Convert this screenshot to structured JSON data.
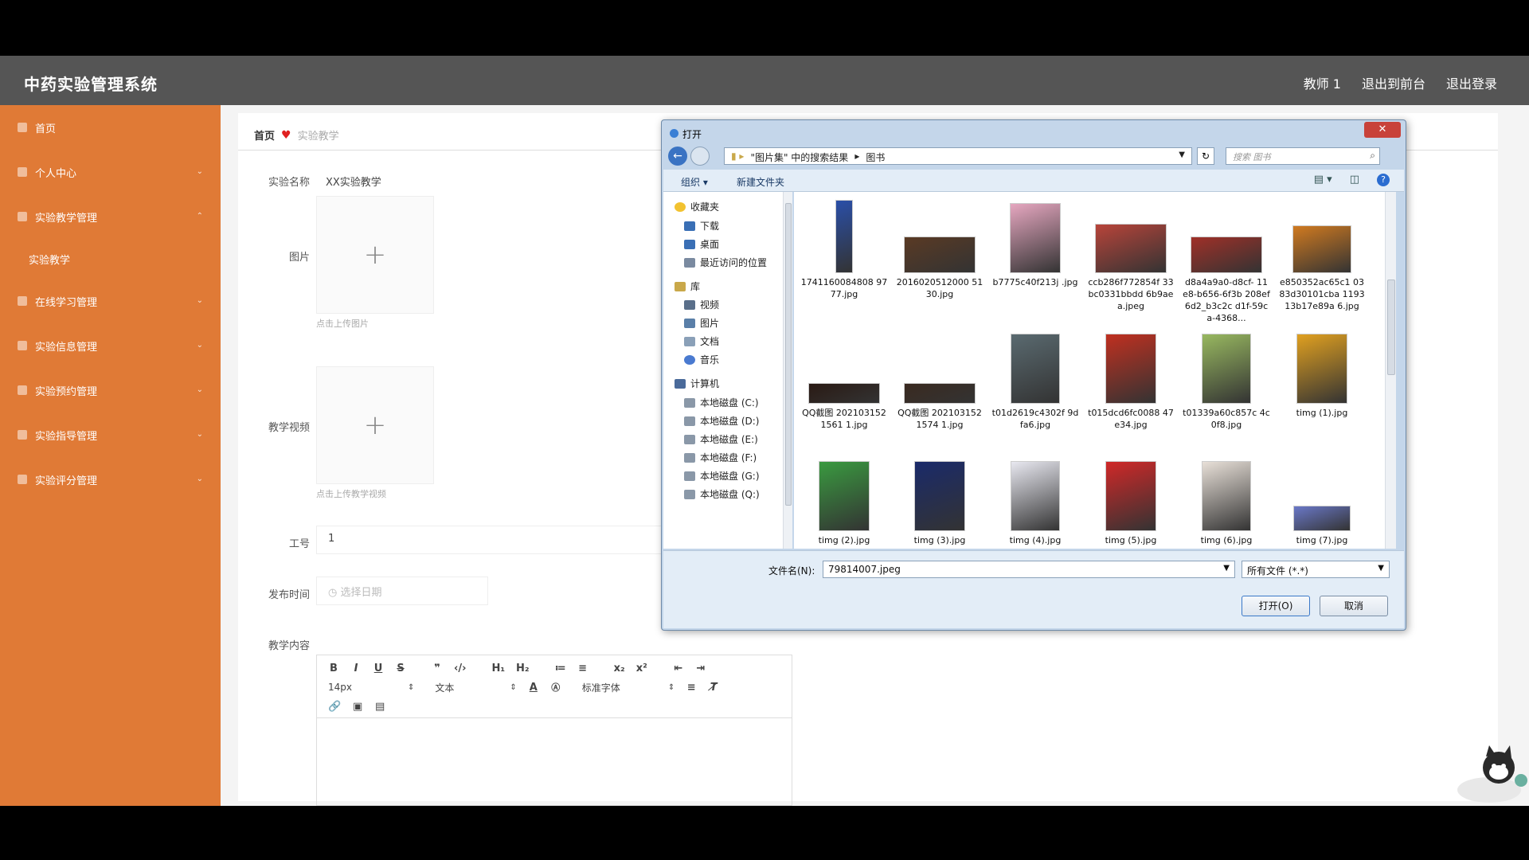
{
  "header": {
    "title": "中药实验管理系统",
    "nav": [
      "教师 1",
      "退出到前台",
      "退出登录"
    ]
  },
  "sidebar": {
    "items": [
      {
        "label": "首页",
        "expandable": false
      },
      {
        "label": "个人中心",
        "expandable": true
      },
      {
        "label": "实验教学管理",
        "expandable": true,
        "open": true
      },
      {
        "label": "在线学习管理",
        "expandable": true
      },
      {
        "label": "实验信息管理",
        "expandable": true
      },
      {
        "label": "实验预约管理",
        "expandable": true
      },
      {
        "label": "实验指导管理",
        "expandable": true
      },
      {
        "label": "实验评分管理",
        "expandable": true
      }
    ],
    "sub_item": "实验教学"
  },
  "breadcrumb": {
    "home": "首页",
    "current": "实验教学"
  },
  "form": {
    "name_label": "实验名称",
    "name_value": "XX实验教学",
    "image_label": "图片",
    "image_hint": "点击上传图片",
    "video_label": "教学视频",
    "video_hint": "点击上传教学视频",
    "id_label": "工号",
    "id_value": "1",
    "time_label": "发布时间",
    "time_placeholder": "选择日期",
    "content_label": "教学内容"
  },
  "editor": {
    "row1": [
      "B",
      "I",
      "U",
      "S",
      "❞",
      "‹/›",
      "H₁",
      "H₂",
      "≔",
      "≡",
      "x₂",
      "x²",
      "⇤",
      "⇥"
    ],
    "font_size": "14px",
    "format": "文本",
    "font": "标准字体",
    "row3": [
      "🔗",
      "▣",
      "▤"
    ]
  },
  "dialog": {
    "title": "打开",
    "close": "✕",
    "path": [
      "\"图片集\" 中的搜索结果",
      "图书"
    ],
    "search_placeholder": "搜索 图书",
    "organize": "组织 ▾",
    "new_folder": "新建文件夹",
    "help": "?",
    "tree": [
      {
        "label": "收藏夹",
        "icon": "star",
        "color": "#f2c230",
        "indent": 0
      },
      {
        "label": "下载",
        "icon": "folder",
        "color": "#3a6fb5",
        "indent": 1
      },
      {
        "label": "桌面",
        "icon": "folder",
        "color": "#3a6fb5",
        "indent": 1
      },
      {
        "label": "最近访问的位置",
        "icon": "folder",
        "color": "#7a8aa0",
        "indent": 1
      },
      {
        "label": "库",
        "icon": "folder",
        "color": "#c9a84a",
        "indent": 0
      },
      {
        "label": "视频",
        "icon": "folder",
        "color": "#5a6f8a",
        "indent": 1
      },
      {
        "label": "图片",
        "icon": "folder",
        "color": "#5a7fa8",
        "indent": 1
      },
      {
        "label": "文档",
        "icon": "folder",
        "color": "#8aa0b8",
        "indent": 1
      },
      {
        "label": "音乐",
        "icon": "music",
        "color": "#4a7ad0",
        "indent": 1
      },
      {
        "label": "计算机",
        "icon": "computer",
        "color": "#4a6a9a",
        "indent": 0
      },
      {
        "label": "本地磁盘 (C:)",
        "icon": "drive",
        "color": "#8a98a8",
        "indent": 1
      },
      {
        "label": "本地磁盘 (D:)",
        "icon": "drive",
        "color": "#8a98a8",
        "indent": 1
      },
      {
        "label": "本地磁盘 (E:)",
        "icon": "drive",
        "color": "#8a98a8",
        "indent": 1
      },
      {
        "label": "本地磁盘 (F:)",
        "icon": "drive",
        "color": "#8a98a8",
        "indent": 1
      },
      {
        "label": "本地磁盘 (G:)",
        "icon": "drive",
        "color": "#8a98a8",
        "indent": 1
      },
      {
        "label": "本地磁盘 (Q:)",
        "icon": "drive",
        "color": "#8a98a8",
        "indent": 1
      }
    ],
    "files": [
      {
        "name": "1741160084808 9777.jpg",
        "color": "#2a4fa8"
      },
      {
        "name": "2016020512000 5130.jpg",
        "color": "#5a3a24"
      },
      {
        "name": "b7775c40f213j .jpg",
        "color": "#e6a7c0"
      },
      {
        "name": "ccb286f772854f 33bc0331bbdd 6b9aea.jpeg",
        "color": "#b8443a"
      },
      {
        "name": "d8a4a9a0-d8cf- 11e8-b656-6f3b 208ef6d2_b3c2c d1f-59ca-4368...",
        "color": "#a03028"
      },
      {
        "name": "e850352ac65c1 0383d30101cba 119313b17e89a 6.jpg",
        "color": "#d07a20"
      },
      {
        "name": "QQ截图 2021031521561 1.jpg",
        "color": "#2a1a14"
      },
      {
        "name": "QQ截图 2021031521574 1.jpg",
        "color": "#3a2a20"
      },
      {
        "name": "t01d2619c4302f 9dfa6.jpg",
        "color": "#5a6a70"
      },
      {
        "name": "t015dcd6fc0088 47e34.jpg",
        "color": "#c03020"
      },
      {
        "name": "t01339a60c857c 4c0f8.jpg",
        "color": "#98b860"
      },
      {
        "name": "timg (1).jpg",
        "color": "#e0a020"
      },
      {
        "name": "timg (2).jpg",
        "color": "#3a9a40"
      },
      {
        "name": "timg (3).jpg",
        "color": "#1a2a6a"
      },
      {
        "name": "timg (4).jpg",
        "color": "#e8e8f0"
      },
      {
        "name": "timg (5).jpg",
        "color": "#d02828"
      },
      {
        "name": "timg (6).jpg",
        "color": "#e8e0d8"
      },
      {
        "name": "timg (7).jpg",
        "color": "#6a78c8"
      }
    ],
    "filename_label": "文件名(N):",
    "filename_value": "79814007.jpeg",
    "filetype": "所有文件 (*.*)",
    "open_button": "打开(O)",
    "cancel_button": "取消"
  },
  "colors": {
    "sidebar": "#e07a36",
    "topbar": "#555555",
    "accent": "#3a78c8"
  }
}
